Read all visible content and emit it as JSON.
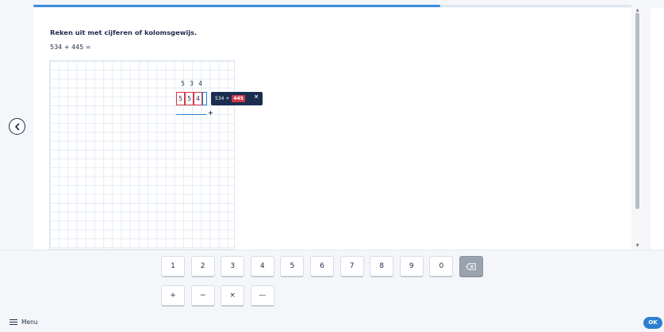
{
  "progress": {
    "fraction": 0.68
  },
  "navigation": {
    "prev_icon": "chevron-left-icon"
  },
  "question": {
    "instruction": "Reken uit met cijferen of kolomsgewijs.",
    "expression": "534 + 445 ="
  },
  "work": {
    "top_digits": [
      "5",
      "3",
      "4"
    ],
    "input_digits": [
      "5",
      "5",
      "4",
      ""
    ],
    "operator": "+",
    "tooltip": {
      "prefix": "534 +",
      "highlight": "445",
      "close_label": "×"
    }
  },
  "keypad": {
    "digits": [
      "1",
      "2",
      "3",
      "4",
      "5",
      "6",
      "7",
      "8",
      "9",
      "0"
    ],
    "backspace_icon": "backspace-icon",
    "operators": [
      "+",
      "−",
      "×",
      "—"
    ]
  },
  "footer": {
    "menu_label": "Menu",
    "ok_label": "OK"
  },
  "colors": {
    "accent": "#2d7fd1",
    "error": "#d3364a",
    "dark": "#1b2e4f"
  }
}
